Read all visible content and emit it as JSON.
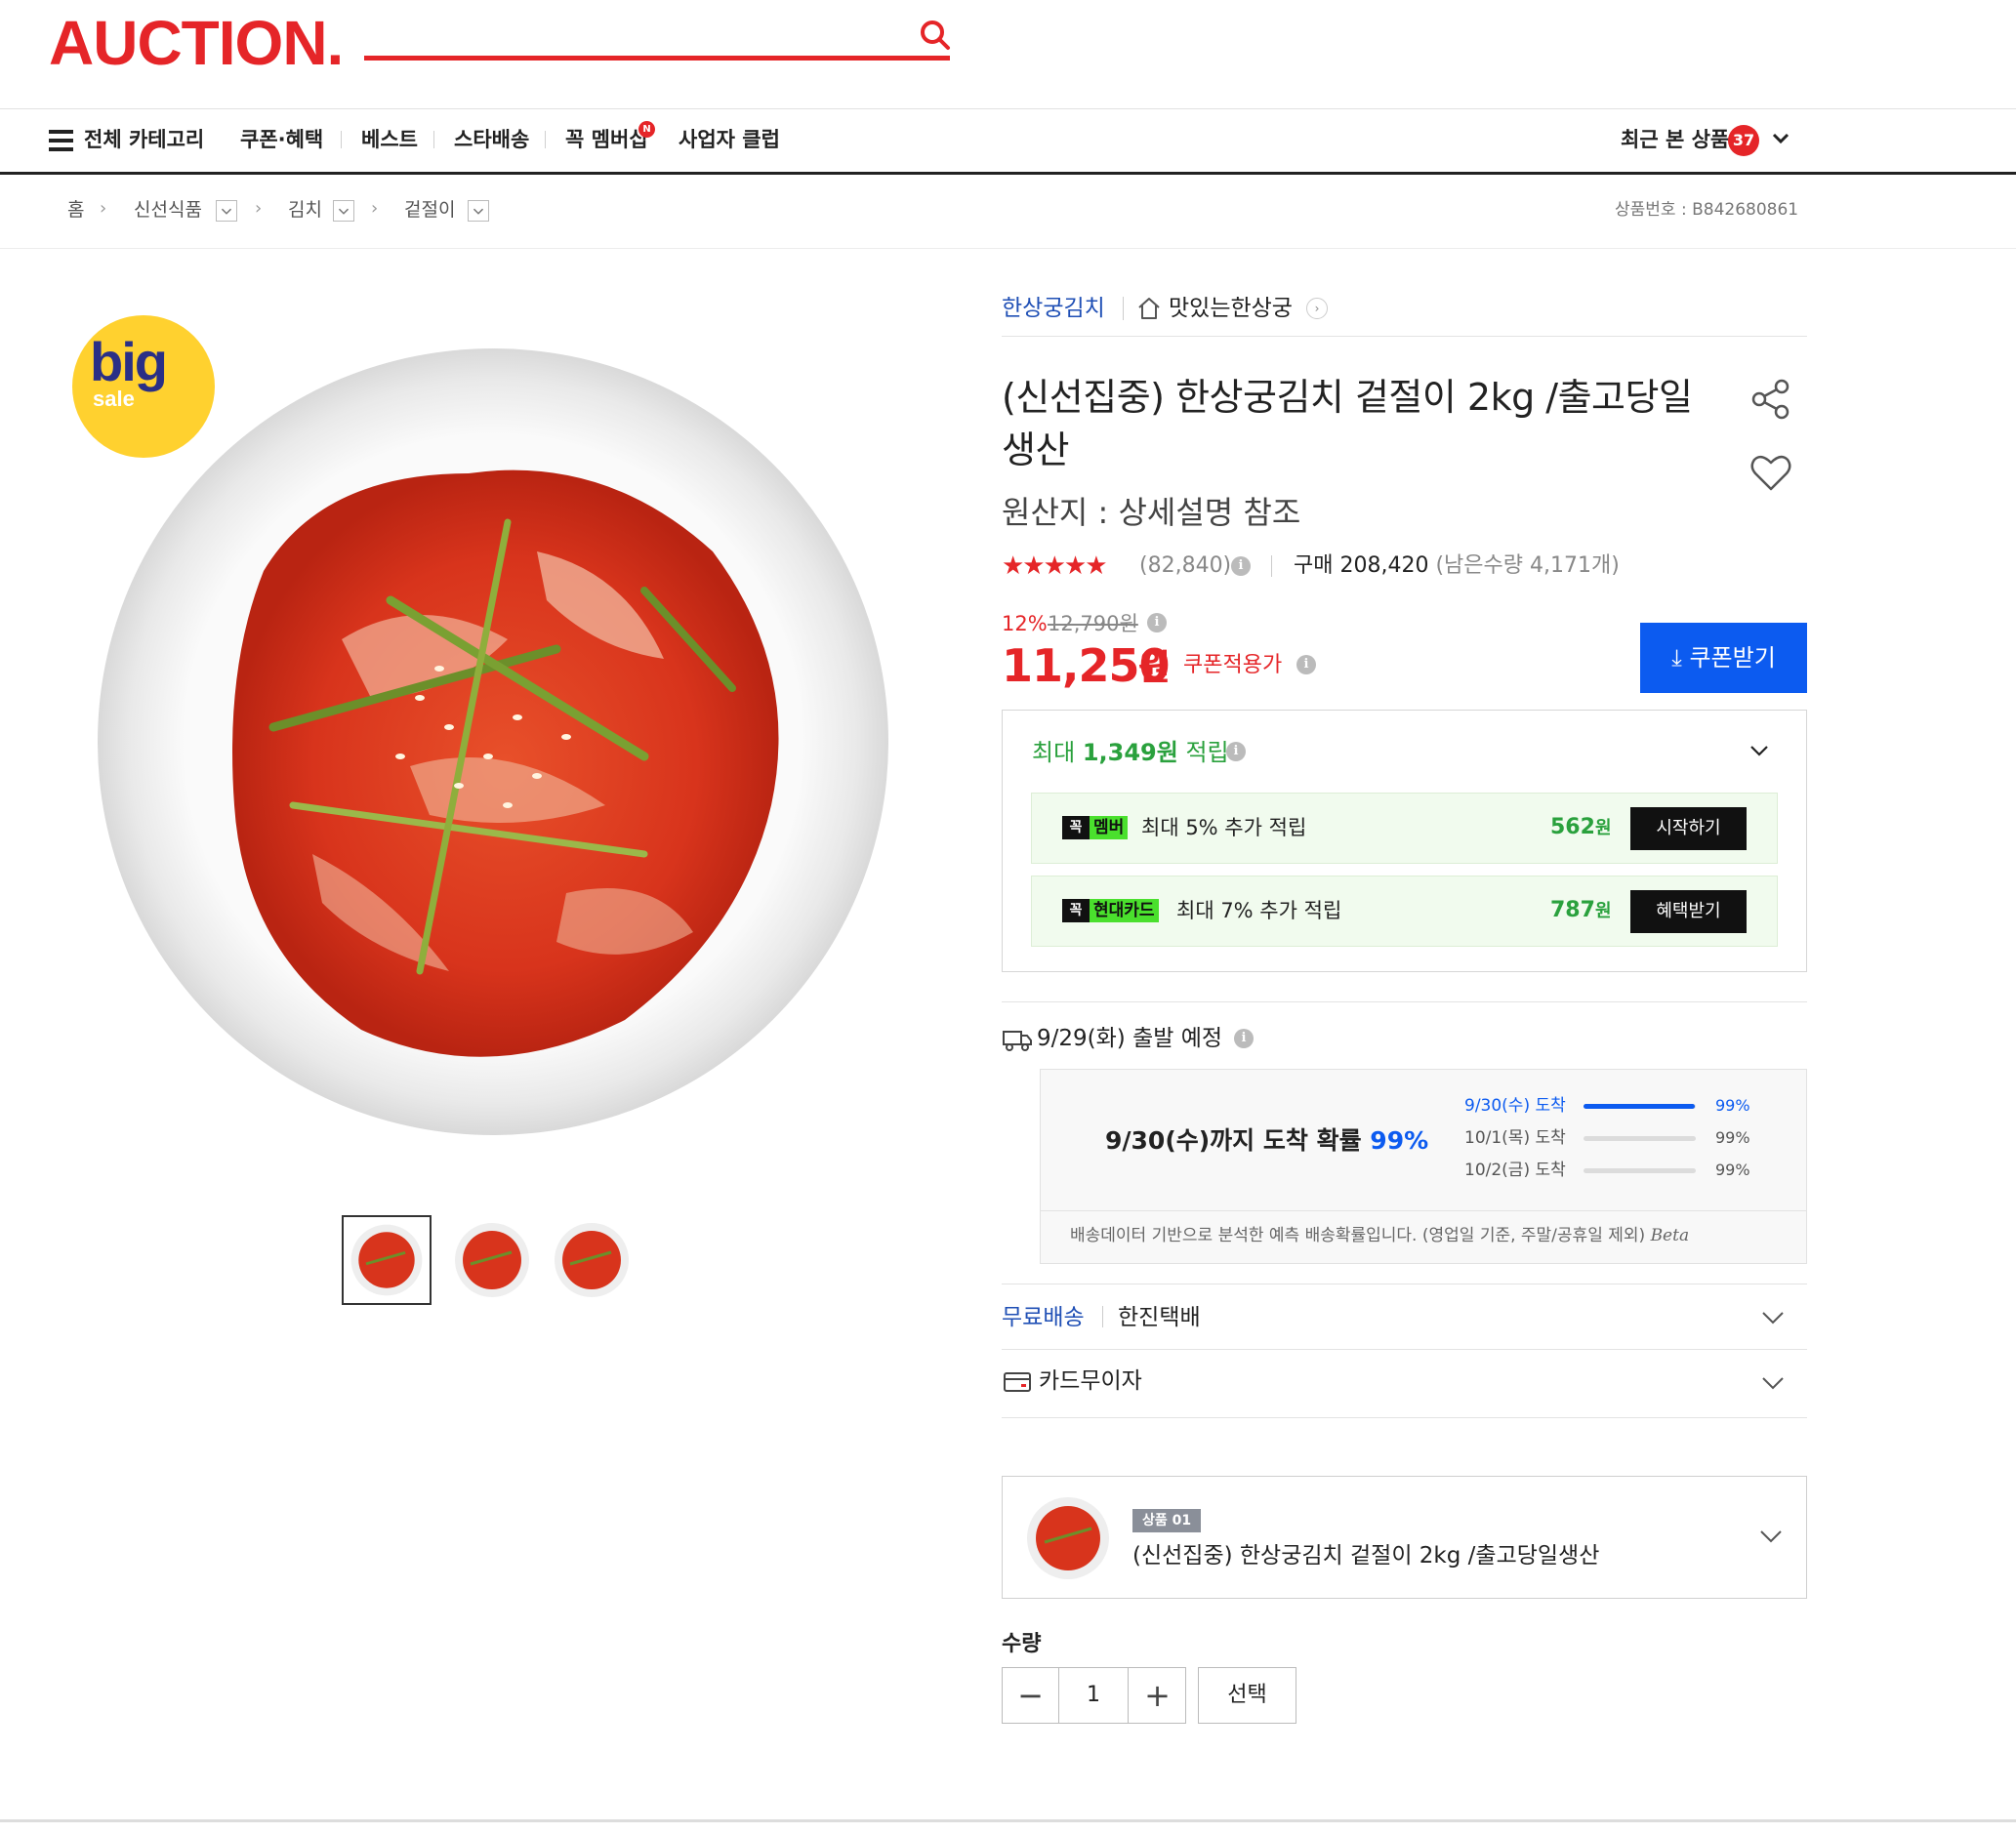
{
  "header": {
    "logo": "AUCTION.",
    "search_placeholder": ""
  },
  "nav": {
    "all_categories": "전체 카테고리",
    "items": [
      "쿠폰·혜택",
      "베스트",
      "스타배송",
      "꼭 멤버십",
      "사업자 클럽"
    ],
    "new_badge": "N",
    "recent_label": "최근 본 상품",
    "recent_count": "37"
  },
  "breadcrumb": {
    "items": [
      "홈",
      "신선식품",
      "김치",
      "겉절이"
    ],
    "product_number": "상품번호 : B842680861"
  },
  "image": {
    "badge_big": "big",
    "badge_sale": "sale"
  },
  "product": {
    "brand": "한상궁김치",
    "store": "맛있는한상궁",
    "title": "(신선집중) 한상궁김치 겉절이 2kg /출고당일생산",
    "origin": "원산지 : 상세설명 참조",
    "rating_stars": 4.5,
    "review_count": "(82,840)",
    "purchase_label": "구매 208,420",
    "stock_label": "(남은수량 4,171개)",
    "discount": "12%",
    "original_price": "12,790원",
    "price": "11,250",
    "price_unit": "원",
    "coupon_price_label": "쿠폰적용가",
    "coupon_button": "쿠폰받기"
  },
  "points": {
    "prefix": "최대",
    "amount": "1,349원",
    "suffix": "적립",
    "rows": [
      {
        "tag_mark": "꼭",
        "tag": "멤버",
        "text": "최대 5% 추가 적립",
        "amount": "562",
        "unit": "원",
        "button": "시작하기"
      },
      {
        "tag_mark": "꼭",
        "tag": "현대카드",
        "text": "최대 7% 추가 적립",
        "amount": "787",
        "unit": "원",
        "button": "혜택받기"
      }
    ]
  },
  "shipping": {
    "departure": "9/29(화) 출발 예정",
    "arrive_main": "9/30(수)까지 도착 확률",
    "arrive_pct": "99%",
    "forecast": [
      {
        "day": "9/30(수) 도착",
        "pct": "99%",
        "fill": 0.99
      },
      {
        "day": "10/1(목) 도착",
        "pct": "99%",
        "fill": 0
      },
      {
        "day": "10/2(금) 도착",
        "pct": "99%",
        "fill": 0
      }
    ],
    "note": "배송데이터 기반으로 분석한 예측 배송확률입니다. (영업일 기준, 주말/공휴일 제외)",
    "beta": "Beta",
    "free_delivery": "무료배송",
    "courier": "한진택배",
    "card_installment": "카드무이자"
  },
  "option": {
    "badge": "상품 01",
    "name": "(신선집중) 한상궁김치 겉절이 2kg /출고당일생산"
  },
  "quantity": {
    "label": "수량",
    "value": "1",
    "select_button": "선택"
  },
  "colors": {
    "brand_red": "#e52528",
    "accent_blue": "#0c5bf0",
    "points_green": "#2aa13d"
  }
}
